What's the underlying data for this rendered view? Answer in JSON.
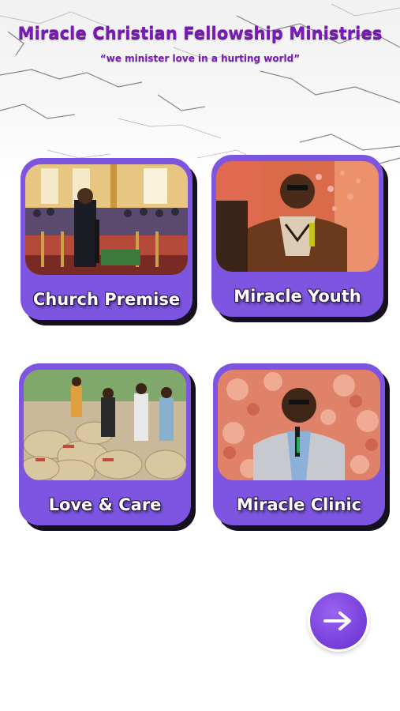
{
  "header": {
    "title": "Miracle Christian Fellowship Ministries",
    "tagline": "“we minister love in a hurting world”"
  },
  "cards": [
    {
      "label": "Church Premise",
      "photo_subject": "church-interior-preacher"
    },
    {
      "label": "Miracle Youth",
      "photo_subject": "youth-speaker-microphone"
    },
    {
      "label": "Love & Care",
      "photo_subject": "food-distribution-sacks"
    },
    {
      "label": "Miracle Clinic",
      "photo_subject": "clinic-speaker-microphone"
    }
  ],
  "next_button": {
    "icon": "arrow-right-icon"
  },
  "colors": {
    "accent": "#7e55e0",
    "title": "#7a1bb8",
    "card_shadow": "#15101f"
  }
}
